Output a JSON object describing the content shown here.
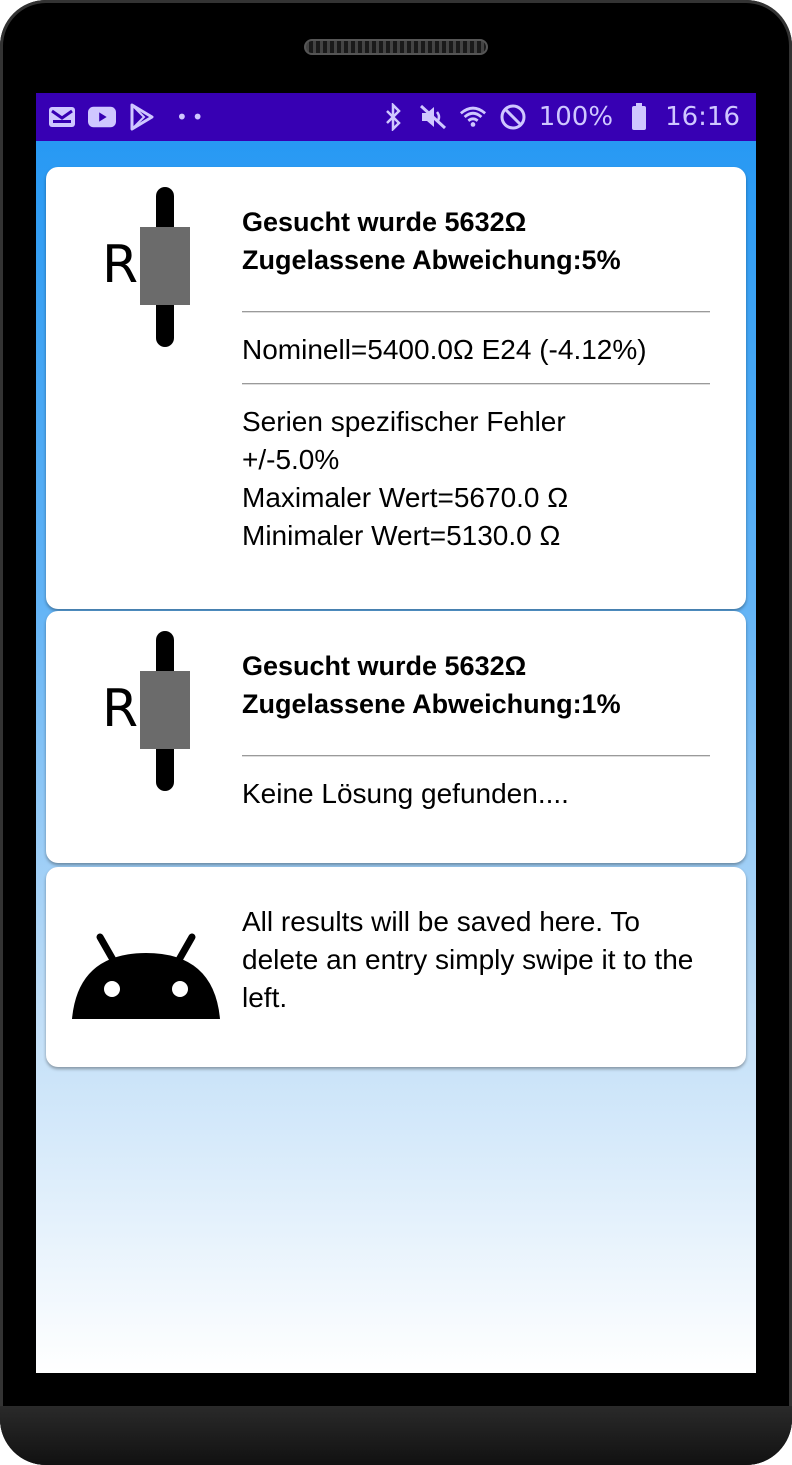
{
  "status_bar": {
    "battery": "100%",
    "time": "16:16",
    "left_icons": [
      "mail-icon",
      "youtube-icon",
      "play-store-icon"
    ],
    "right_icons": [
      "bluetooth-icon",
      "mute-icon",
      "wifi-icon",
      "do-not-disturb-icon",
      "battery-icon"
    ]
  },
  "results": [
    {
      "icon": "resistor-icon",
      "icon_letter": "R",
      "title_line1": "Gesucht wurde 5632Ω",
      "title_line2": "Zugelassene Abweichung:5%",
      "nominal": "Nominell=5400.0Ω E24 (-4.12%)",
      "details": [
        "Serien spezifischer Fehler",
        "+/-5.0%",
        "Maximaler Wert=5670.0 Ω",
        "Minimaler Wert=5130.0 Ω"
      ]
    },
    {
      "icon": "resistor-icon",
      "icon_letter": "R",
      "title_line1": "Gesucht wurde 5632Ω",
      "title_line2": "Zugelassene Abweichung:1%",
      "message": "Keine Lösung gefunden...."
    }
  ],
  "info_card": {
    "icon": "android-icon",
    "text": "All results will be saved here. To delete an entry simply swipe it to the left."
  },
  "colors": {
    "status_bar": "#3700b3",
    "background_top": "#2196f3",
    "resistor_body": "#6b6b6b"
  }
}
